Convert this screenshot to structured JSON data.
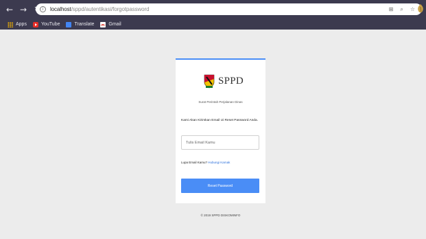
{
  "browser": {
    "back_icon": "arrow-left-icon",
    "forward_icon": "arrow-right-icon",
    "reload_icon": "reload-icon",
    "url_host": "localhost",
    "url_path": "/sppd/autentikasi/forgotpassword",
    "bookmarks": [
      "Apps",
      "YouTube",
      "Translate",
      "Gmail"
    ]
  },
  "card": {
    "brand": "SPPD",
    "subtitle": "Surat Perintah Perjalanan Dinas",
    "intro": "Kami Akan Kirimkan Email Ui Reset Password Anda.",
    "email_placeholder": "Tulis Email Kamu",
    "help_text": "Lupa Email Kamu?",
    "help_link": "Hubungi Kamak",
    "button_label": "Reset Password"
  },
  "footer": "© 2019 SPPD DISKOMINFO",
  "colors": {
    "accent": "#4a8df6",
    "chrome": "#3c3a4f",
    "background": "#ececec"
  }
}
